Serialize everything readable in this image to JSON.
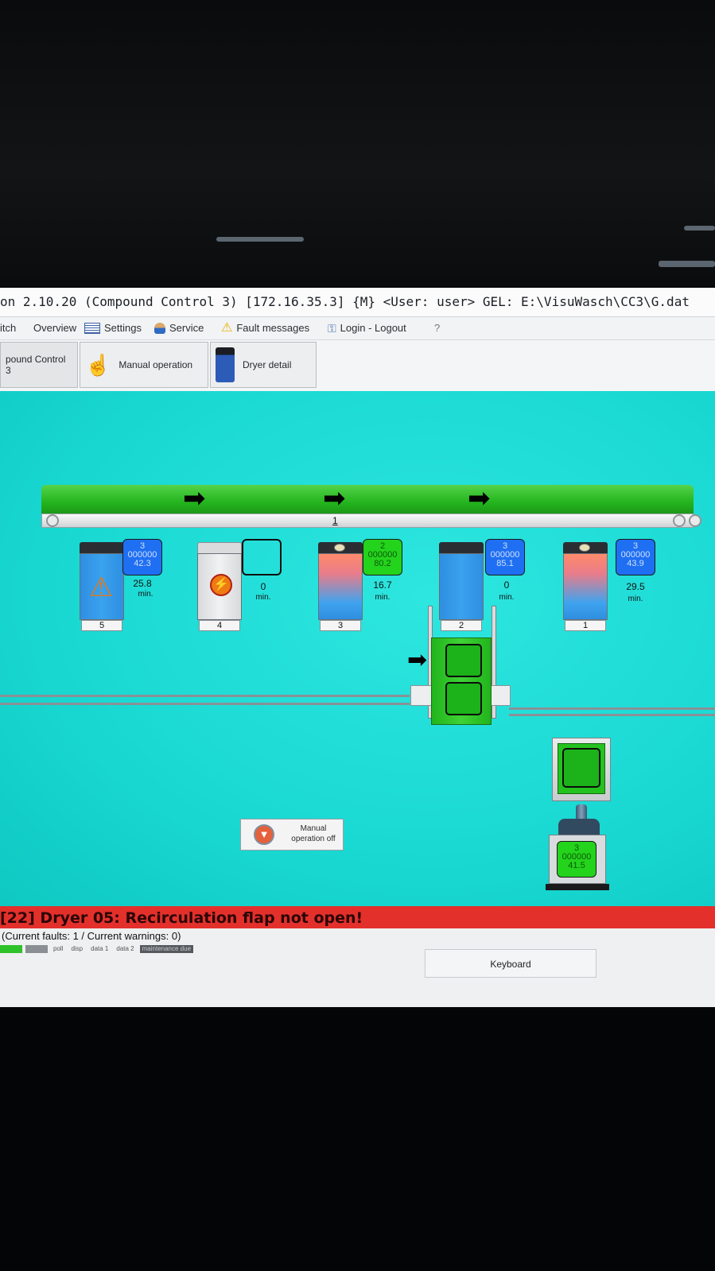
{
  "window": {
    "title": "on 2.10.20 (Compound Control 3) [172.16.35.3] {M} <User: user>  GEL: E:\\VisuWasch\\CC3\\G.dat"
  },
  "menu": {
    "items": [
      "itch",
      "Overview",
      "Settings",
      "Service",
      "Fault messages",
      "Login - Logout",
      "?"
    ]
  },
  "toolbar": {
    "tab_compound": "pound Control 3",
    "manual_operation": "Manual operation",
    "dryer_detail": "Dryer detail"
  },
  "conveyor": {
    "number": "1"
  },
  "dryers": [
    {
      "number": "5",
      "status_top": "3",
      "status_mid": "000000",
      "status_val": "42.3",
      "time": "25.8",
      "unit": "min."
    },
    {
      "number": "4",
      "status_top": "",
      "status_mid": "",
      "status_val": "",
      "time": "0",
      "unit": "min."
    },
    {
      "number": "3",
      "status_top": "2",
      "status_mid": "000000",
      "status_val": "80.2",
      "time": "16.7",
      "unit": "min."
    },
    {
      "number": "2",
      "status_top": "3",
      "status_mid": "000000",
      "status_val": "85.1",
      "time": "0",
      "unit": "min."
    },
    {
      "number": "1",
      "status_top": "3",
      "status_mid": "000000",
      "status_val": "43.9",
      "time": "29.5",
      "unit": "min."
    }
  ],
  "lift_station": {
    "status_top": "3",
    "status_mid": "000000",
    "status_val": "41.5"
  },
  "manual_off": {
    "line1": "Manual",
    "line2": "operation off"
  },
  "fault": {
    "message": "[22] Dryer 05:    Recirculation flap not open!",
    "counts": "(Current faults:  1 / Current warnings:  0)"
  },
  "status_leds": [
    "run",
    "idle",
    "poll",
    "disp",
    "data 1",
    "data 2",
    "maintenance due"
  ],
  "keyboard": "Keyboard",
  "colors": {
    "process_bg": "#19d8d2",
    "conveyor_green": "#24b51e",
    "status_blue": "#1f6ff2",
    "status_green": "#24d31c",
    "fault_red": "#e3302b"
  }
}
